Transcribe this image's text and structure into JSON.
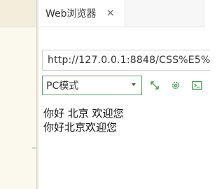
{
  "browser": {
    "tab": {
      "title": "Web浏览器",
      "close_glyph": "×"
    },
    "address": {
      "url": "http://127.0.0.1:8848/CSS%E5%"
    },
    "toolbar": {
      "mode_selected": "PC模式",
      "icons": [
        "screenshot-icon",
        "settings-gear-icon",
        "console-icon"
      ],
      "accent_color": "#3fa34d"
    },
    "page": {
      "lines": [
        "你好 北京 欢迎您",
        "你好北京欢迎您"
      ]
    }
  }
}
